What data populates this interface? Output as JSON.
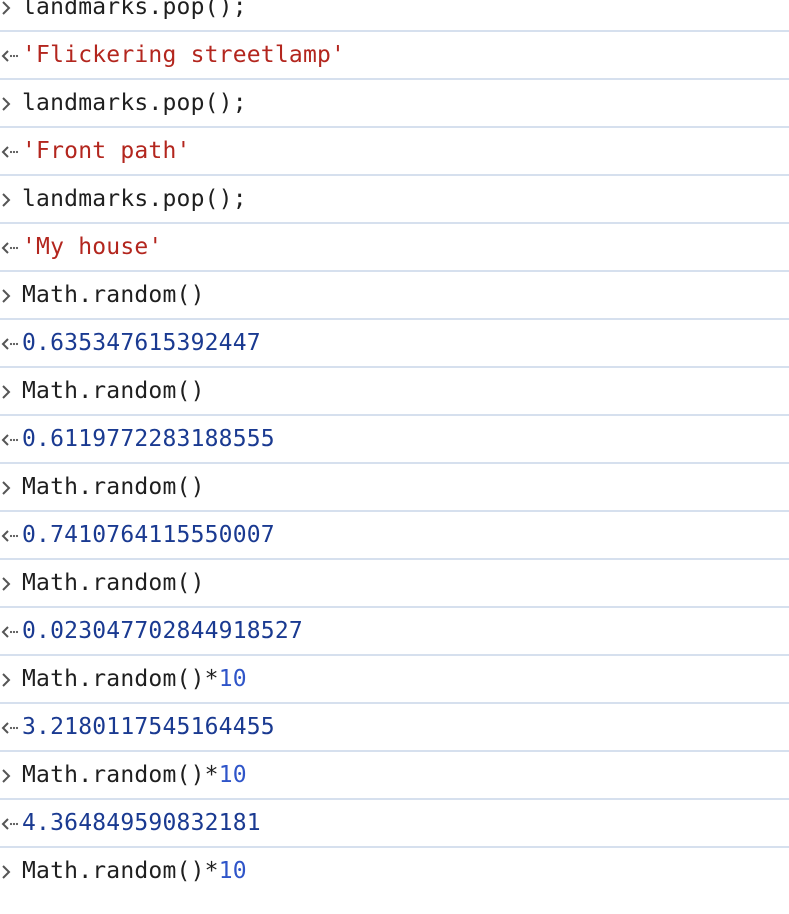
{
  "console": {
    "entries": [
      {
        "kind": "input",
        "text": "landmarks.pop();"
      },
      {
        "kind": "output",
        "type": "string",
        "text": "'Flickering streetlamp'"
      },
      {
        "kind": "input",
        "text": "landmarks.pop();"
      },
      {
        "kind": "output",
        "type": "string",
        "text": "'Front path'"
      },
      {
        "kind": "input",
        "text": "landmarks.pop();"
      },
      {
        "kind": "output",
        "type": "string",
        "text": "'My house'"
      },
      {
        "kind": "input",
        "text": "Math.random()"
      },
      {
        "kind": "output",
        "type": "number",
        "text": "0.635347615392447"
      },
      {
        "kind": "input",
        "text": "Math.random()"
      },
      {
        "kind": "output",
        "type": "number",
        "text": "0.6119772283188555"
      },
      {
        "kind": "input",
        "text": "Math.random()"
      },
      {
        "kind": "output",
        "type": "number",
        "text": "0.7410764115550007"
      },
      {
        "kind": "input",
        "text": "Math.random()"
      },
      {
        "kind": "output",
        "type": "number",
        "text": "0.023047702844918527"
      },
      {
        "kind": "input",
        "text": "Math.random()",
        "op": "*",
        "literal": "10"
      },
      {
        "kind": "output",
        "type": "number",
        "text": "3.2180117545164455"
      },
      {
        "kind": "input",
        "text": "Math.random()",
        "op": "*",
        "literal": "10"
      },
      {
        "kind": "output",
        "type": "number",
        "text": "4.364849590832181"
      },
      {
        "kind": "input",
        "text": "Math.random()",
        "op": "*",
        "literal": "10"
      }
    ]
  },
  "colors": {
    "command": "#1f1f1f",
    "string": "#b3261e",
    "number": "#1a3a91",
    "literal": "#2f55c9",
    "separator": "#d6e0ee",
    "arrow": "#555555"
  },
  "icons": {
    "input": "input-chevron-icon",
    "output": "return-value-icon"
  }
}
